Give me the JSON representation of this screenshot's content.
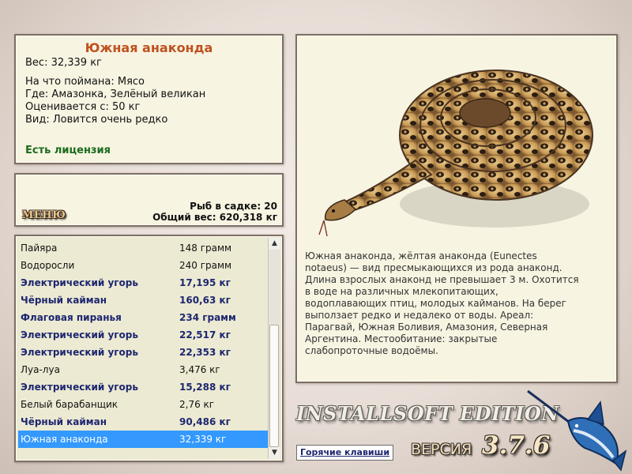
{
  "info": {
    "title": "Южная анаконда",
    "weight": "Вес: 32,339 кг",
    "details": [
      "На что поймана: Мясо",
      "Где: Амазонка, Зелёный великан",
      "Оценивается с: 50 кг",
      "Вид: Ловится очень редко"
    ],
    "license": "Есть лицензия"
  },
  "stats": {
    "menu_label": "МЕНЮ",
    "fish_in_cage": "Рыб в садке: 20",
    "total_weight": "Общий вес: 620,318 кг"
  },
  "catch_list": [
    {
      "name": "Пайяра",
      "weight": "148 грамм",
      "style": "normal"
    },
    {
      "name": "Водоросли",
      "weight": "240 грамм",
      "style": "normal"
    },
    {
      "name": "Электрический угорь",
      "weight": "17,195 кг",
      "style": "bold"
    },
    {
      "name": "Чёрный кайман",
      "weight": "160,63 кг",
      "style": "bold"
    },
    {
      "name": "Флаговая пиранья",
      "weight": "234 грамм",
      "style": "bold"
    },
    {
      "name": "Электрический угорь",
      "weight": "22,517 кг",
      "style": "bold"
    },
    {
      "name": "Электрический угорь",
      "weight": "22,353 кг",
      "style": "bold"
    },
    {
      "name": "Луа-луа",
      "weight": "3,476 кг",
      "style": "normal"
    },
    {
      "name": "Электрический угорь",
      "weight": "15,288 кг",
      "style": "bold"
    },
    {
      "name": "Белый барабанщик",
      "weight": "2,76 кг",
      "style": "normal"
    },
    {
      "name": "Чёрный кайман",
      "weight": "90,486 кг",
      "style": "bold"
    },
    {
      "name": "Южная анаконда",
      "weight": "32,339 кг",
      "style": "selected"
    }
  ],
  "description": {
    "lines": [
      "Южная анаконда, жёлтая анаконда (Eunectes",
      "notaeus) — вид пресмыкающихся из рода анаконд.",
      "Длина взрослых анаконд не превышает 3 м. Охотится",
      "в воде на различных млекопитающих,",
      "водоплавающих птиц, молодых кайманов. На берег",
      "выползает редко и недалеко от воды. Ареал:",
      "Парагвай, Южная Боливия, Амазония, Северная",
      "Аргентина. Местообитание: закрытые",
      "слабопроточные водоёмы."
    ]
  },
  "footer": {
    "brand": "INSTALLSOFT EDITION",
    "version_label": "ВЕРСИЯ",
    "version_number": "3.7.6",
    "hotkeys_label": "Горячие клавиши"
  },
  "icons": {
    "snake": "anaconda-picture",
    "fish": "marlin-fish-icon",
    "scroll_up": "chevron-up-icon",
    "scroll_down": "chevron-down-icon"
  },
  "colors": {
    "title": "#c0511f",
    "license": "#1b6b1b",
    "bold_row": "#1d2670",
    "selected_row": "#3399ff",
    "panel_bg": "#f7f4e2"
  }
}
